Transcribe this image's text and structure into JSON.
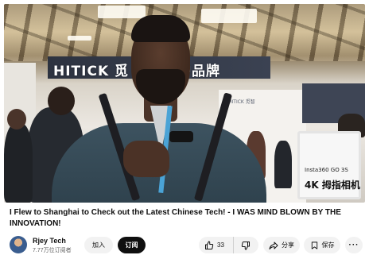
{
  "video": {
    "banner_text": "HITICK 觅 智能个护品牌",
    "booth_sign": "HITICK 觅智",
    "monitor_small": "Insta360 GO 3S",
    "monitor_big": "4K 拇指相机"
  },
  "info": {
    "title": "I Flew to Shanghai to Check out the Latest Chinese Tech! - I WAS MIND BLOWN BY THE INNOVATION!",
    "channel_name": "Rjey Tech",
    "subscribers": "7.77万位订阅者",
    "join_label": "加入",
    "subscribe_label": "订阅"
  },
  "actions": {
    "like_count": "33",
    "share_label": "分享",
    "save_label": "保存",
    "more_label": "···"
  },
  "icons": [
    "thumbs-up-icon",
    "thumbs-down-icon",
    "share-icon",
    "save-icon",
    "more-icon"
  ],
  "colors": {
    "subscribe_bg": "#0f0f0f",
    "pill_bg": "#f2f2f2",
    "secondary_text": "#606060"
  }
}
